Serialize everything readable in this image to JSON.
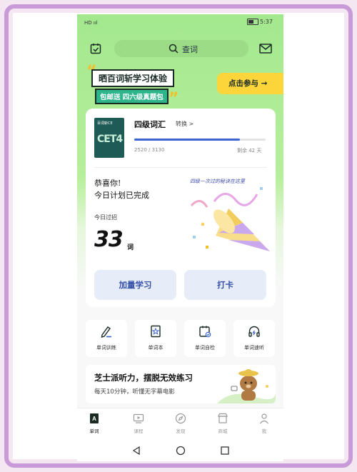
{
  "status_bar": {
    "signal": "HD ııl",
    "time": "5:37"
  },
  "search": {
    "label": "查词"
  },
  "banner": {
    "title": "晒百词斩学习体验",
    "subtitle": "包邮送 四六级真题包",
    "cta": "点击参与 →",
    "accent_color": "#fbd53a"
  },
  "book": {
    "cover_brand": "百词斩CE",
    "cover_text": "CET4",
    "title": "四级词汇",
    "switch_label": "转换 >",
    "learned": 2520,
    "total": 3130,
    "progress_text": "2520 / 3130",
    "days_left": "剩余 42 天"
  },
  "today": {
    "congrats_line1": "恭喜你!",
    "congrats_line2": "今日计划已完成",
    "secret_text": "四级一次过的秘诀在这里",
    "passed_label": "今日过招",
    "passed_count": "33",
    "passed_unit": "词"
  },
  "actions": {
    "more_study": "加量学习",
    "check_in": "打卡"
  },
  "tools": [
    {
      "label": "单词训练",
      "icon": "pencil-icon"
    },
    {
      "label": "单词本",
      "icon": "star-book-icon"
    },
    {
      "label": "单词自检",
      "icon": "calendar-check-icon"
    },
    {
      "label": "单词速听",
      "icon": "headphones-icon"
    }
  ],
  "promo": {
    "title": "芝士派听力，摆脱无效练习",
    "subtitle": "每天10分钟，听懂无字幕电影"
  },
  "nav": [
    {
      "label": "单词",
      "icon": "book-a-icon",
      "active": true
    },
    {
      "label": "课程",
      "icon": "video-icon",
      "active": false
    },
    {
      "label": "发现",
      "icon": "compass-icon",
      "active": false
    },
    {
      "label": "商城",
      "icon": "shop-icon",
      "active": false
    },
    {
      "label": "我",
      "icon": "person-icon",
      "active": false
    }
  ],
  "colors": {
    "brand_green": "#a3e88e",
    "progress_blue": "#3b63d6",
    "button_bg": "#e7ecf9",
    "frame_purple": "#c89ad8"
  }
}
